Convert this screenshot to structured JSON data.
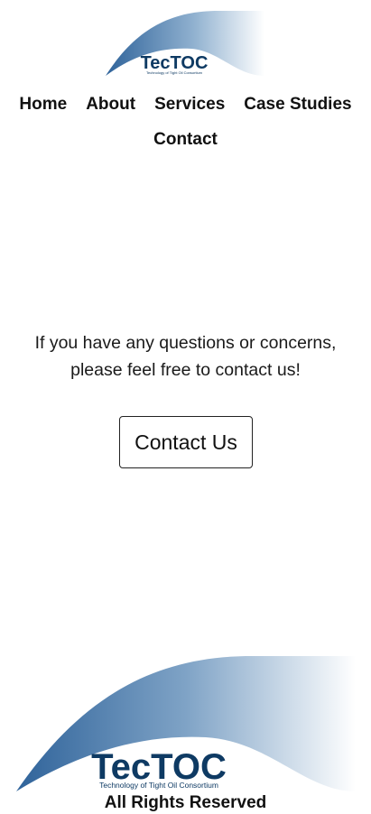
{
  "brand": {
    "name": "TecTOC",
    "tagline": "Technology of Tight Oil Consortium",
    "primary_color": "#0e3a63",
    "swoosh_color": "#3f73a4"
  },
  "nav": {
    "items": [
      {
        "label": "Home"
      },
      {
        "label": "About"
      },
      {
        "label": "Services"
      },
      {
        "label": "Case Studies"
      },
      {
        "label": "Contact"
      }
    ]
  },
  "main": {
    "message_line1": "If you have any questions or concerns,",
    "message_line2": "please feel free to contact us!",
    "contact_button_label": "Contact Us"
  },
  "footer": {
    "text": "All Rights Reserved"
  }
}
